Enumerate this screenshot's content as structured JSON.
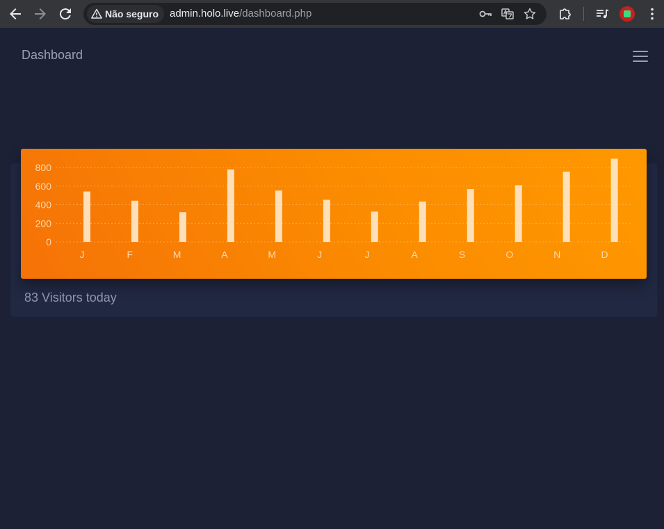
{
  "browser": {
    "security_label": "Não seguro",
    "url_host": "admin.holo.live",
    "url_path": "/dashboard.php"
  },
  "header": {
    "title": "Dashboard"
  },
  "card": {
    "footer_text": "83 Visitors today"
  },
  "chart_data": {
    "type": "bar",
    "categories": [
      "J",
      "F",
      "M",
      "A",
      "M",
      "J",
      "J",
      "A",
      "S",
      "O",
      "N",
      "D"
    ],
    "values": [
      542,
      443,
      320,
      780,
      553,
      453,
      326,
      434,
      568,
      610,
      756,
      895
    ],
    "yticks": [
      "800",
      "600",
      "400",
      "200",
      "0"
    ],
    "ylim": [
      0,
      800
    ],
    "grid": true,
    "colors": {
      "bar": "#fde7c9",
      "panel_start": "#f57207",
      "panel_end": "#ff9800",
      "label": "#fcd9b0",
      "grid": "#fdbb6a"
    }
  }
}
